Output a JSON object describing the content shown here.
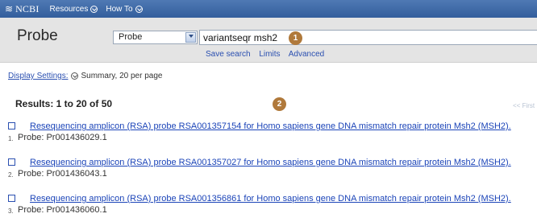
{
  "topbar": {
    "logo_text": "NCBI",
    "menus": [
      {
        "label": "Resources"
      },
      {
        "label": "How To"
      }
    ]
  },
  "search": {
    "db_title": "Probe",
    "db_selected": "Probe",
    "term": "variantseqr msh2",
    "links": [
      "Save search",
      "Limits",
      "Advanced"
    ]
  },
  "callouts": [
    "1",
    "2"
  ],
  "display_settings": {
    "link_label": "Display Settings:",
    "value": "Summary, 20 per page"
  },
  "results": {
    "header": "Results: 1 to 20 of 50",
    "first_label": "<< First",
    "items": [
      {
        "num": "1.",
        "title": "Resequencing amplicon (RSA) probe RSA001357154 for Homo sapiens gene DNA mismatch repair protein Msh2 (MSH2).",
        "sub": "Probe: Pr001436029.1"
      },
      {
        "num": "2.",
        "title": "Resequencing amplicon (RSA) probe RSA001357027 for Homo sapiens gene DNA mismatch repair protein Msh2 (MSH2).",
        "sub": "Probe: Pr001436043.1"
      },
      {
        "num": "3.",
        "title": "Resequencing amplicon (RSA) probe RSA001356861 for Homo sapiens gene DNA mismatch repair protein Msh2 (MSH2).",
        "sub": "Probe: Pr001436060.1"
      }
    ]
  },
  "colors": {
    "topbar": "#3f6aa8",
    "link": "#1b44b8",
    "callout": "#b0793b",
    "search_band": "#e4e4e4"
  }
}
